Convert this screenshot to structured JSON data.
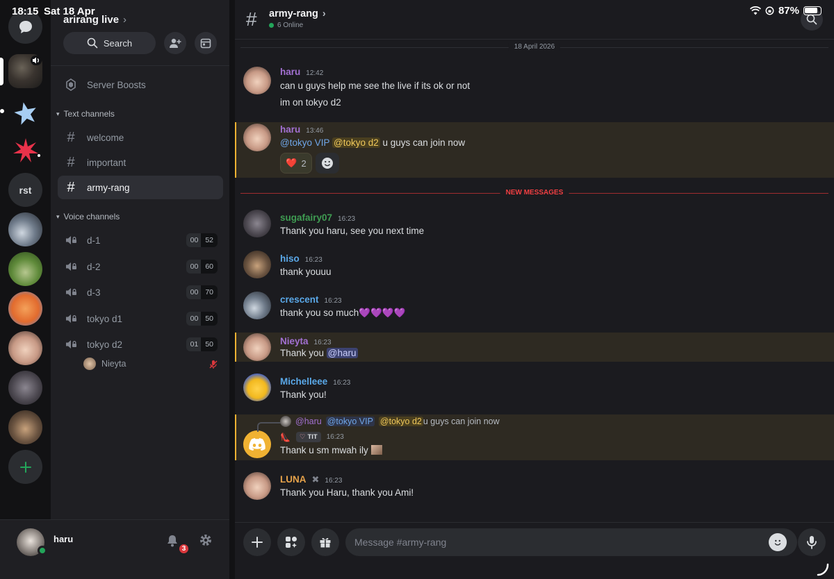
{
  "status_bar": {
    "time": "18:15",
    "date": "Sat 18 Apr",
    "battery": "87%"
  },
  "server": {
    "name": "arirang live"
  },
  "sidebar": {
    "search_label": "Search",
    "boosts_label": "Server Boosts",
    "text_category": "Text channels",
    "voice_category": "Voice channels",
    "text_channels": [
      {
        "name": "welcome"
      },
      {
        "name": "important"
      },
      {
        "name": "army-rang",
        "active": true
      }
    ],
    "voice_channels": [
      {
        "name": "d-1",
        "current": "00",
        "limit": "52"
      },
      {
        "name": "d-2",
        "current": "00",
        "limit": "60"
      },
      {
        "name": "d-3",
        "current": "00",
        "limit": "70"
      },
      {
        "name": "tokyo d1",
        "current": "00",
        "limit": "50"
      },
      {
        "name": "tokyo d2",
        "current": "01",
        "limit": "50"
      }
    ],
    "voice_user": "Nieyta"
  },
  "rail": {
    "rst_label": "rst"
  },
  "user_panel": {
    "name": "haru",
    "badge": "3"
  },
  "chat": {
    "channel": "army-rang",
    "online": "6 Online",
    "date_divider": "18 April 2026",
    "new_divider": "NEW MESSAGES",
    "messages": [
      {
        "author": "haru",
        "time": "12:42",
        "lines": [
          "can u guys help me see the live if its ok or not",
          "im on tokyo d2"
        ]
      },
      {
        "author": "haru",
        "time": "13:46",
        "mention1": "@tokyo VIP",
        "mention2": "@tokyo d2",
        "text": " u guys can join now",
        "reactions": [
          {
            "emoji": "❤️",
            "count": "2"
          }
        ]
      },
      {
        "author": "sugafairy07",
        "time": "16:23",
        "text": "Thank you haru, see you next time"
      },
      {
        "author": "hiso",
        "time": "16:23",
        "text": "thank youuu"
      },
      {
        "author": "crescent",
        "time": "16:23",
        "text": "thank you so much💜💜💜💜"
      },
      {
        "author": "Nieyta",
        "time": "16:23",
        "text": "Thank you ",
        "mention": "@haru"
      },
      {
        "author": "Michelleee",
        "time": "16:23",
        "text": "Thank you!"
      },
      {
        "reply_author": "@haru",
        "reply_m1": "@tokyo VIP",
        "reply_m2": "@tokyo d2",
        "reply_text": " u guys can join now",
        "tag": "TIT",
        "time": "16:23",
        "text": "Thank u sm mwah ily"
      },
      {
        "author": "LUNA",
        "time": "16:23",
        "text": "Thank you Haru, thank you Ami!"
      }
    ]
  },
  "composer": {
    "placeholder": "Message #army-rang"
  },
  "colors": {
    "haru": "#a270d1",
    "sugafairy07": "#3f9c52",
    "hiso": "#5aa8e8",
    "crescent": "#5aa8e8",
    "nieyta": "#a270d1",
    "michelleee": "#5aa8e8",
    "luna": "#e6a24a",
    "highlight": "#f0b232"
  }
}
